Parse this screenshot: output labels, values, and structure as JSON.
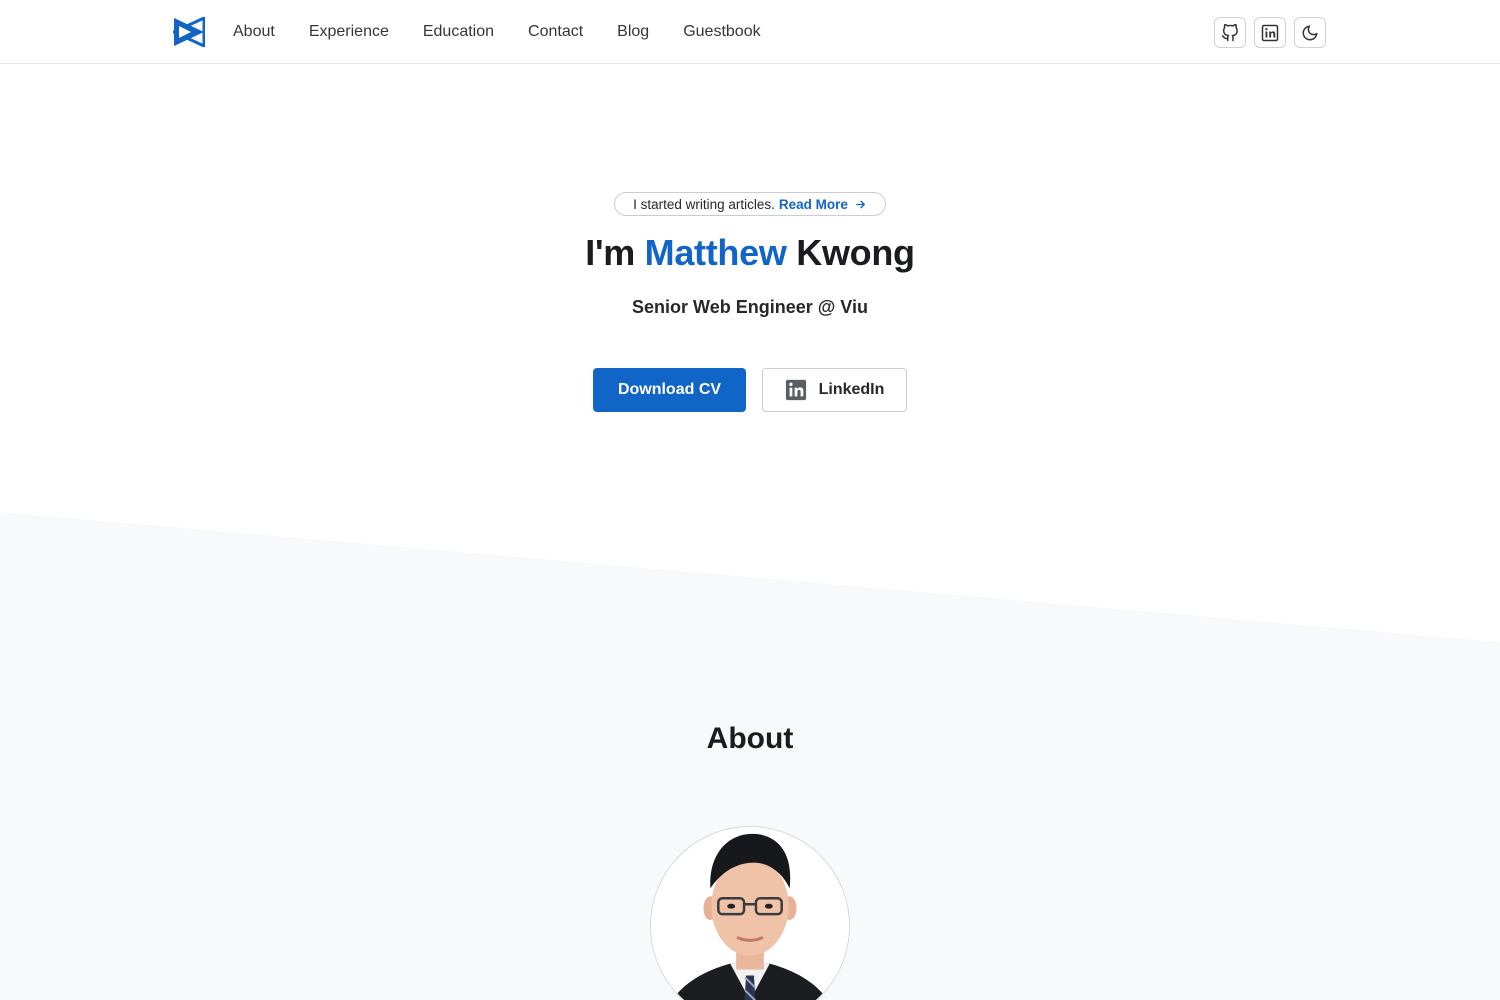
{
  "nav": {
    "logo_icon": "bowtie-logo-icon",
    "items": [
      {
        "label": "About"
      },
      {
        "label": "Experience"
      },
      {
        "label": "Education"
      },
      {
        "label": "Contact"
      },
      {
        "label": "Blog"
      },
      {
        "label": "Guestbook"
      }
    ],
    "icon_buttons": [
      "github-icon",
      "linkedin-icon",
      "moon-icon"
    ]
  },
  "hero": {
    "announcement_text": "I started writing articles.",
    "announcement_link": "Read More",
    "title_prefix": "I'm",
    "title_first_name": "Matthew",
    "title_last_name": "Kwong",
    "subtitle": "Senior Web Engineer @ Viu",
    "primary_button": "Download CV",
    "secondary_button": "LinkedIn"
  },
  "about": {
    "title": "About"
  },
  "colors": {
    "accent": "#1065c7",
    "text": "#1b1c20",
    "band_background": "#f8f9fb"
  }
}
